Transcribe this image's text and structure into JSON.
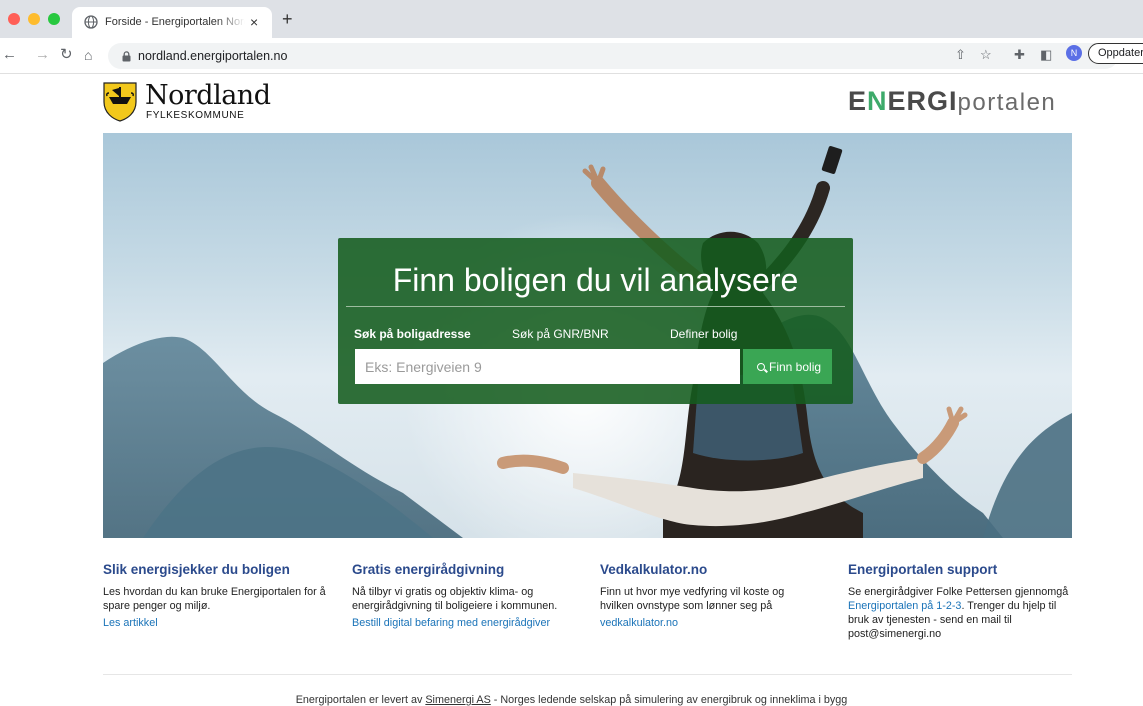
{
  "browser": {
    "tab_title": "Forside - Energiportalen Nordland",
    "tab_close": "×",
    "new_tab": "+",
    "url": "nordland.energiportalen.no",
    "profile_initial": "N",
    "update_label": "Oppdater"
  },
  "header": {
    "left_logo_name": "Nordland",
    "left_logo_sub": "FYLKESKOMMUNE",
    "right_logo": {
      "part1": "E",
      "part2": "N",
      "part3": "ERGI",
      "part4": "portalen"
    }
  },
  "search": {
    "title": "Finn boligen du vil analysere",
    "tabs": [
      {
        "label": "Søk på boligadresse",
        "active": true
      },
      {
        "label": "Søk på GNR/BNR",
        "active": false
      },
      {
        "label": "Definer bolig",
        "active": false
      }
    ],
    "placeholder": "Eks: Energiveien 9",
    "button_label": "Finn bolig"
  },
  "info": [
    {
      "title": "Slik energisjekker du boligen",
      "text": "Les hvordan du kan bruke Energiportalen for å spare penger og miljø.",
      "link": "Les artikkel"
    },
    {
      "title": "Gratis energirådgivning",
      "text": "Nå tilbyr vi gratis og objektiv klima- og energirådgivning til boligeiere i kommunen.",
      "link": "Bestill digital befaring med energirådgiver"
    },
    {
      "title": "Vedkalkulator.no",
      "text": "Finn ut hvor mye vedfyring vil koste og hvilken ovnstype som lønner seg på",
      "link": "vedkalkulator.no"
    },
    {
      "title": "Energiportalen support",
      "text_before": "Se energirådgiver Folke Pettersen gjennomgå",
      "link": "Energiportalen på 1-2-3",
      "text_after": ". Trenger du hjelp til bruk av tjenesten - send en mail til post@simenergi.no"
    }
  ],
  "footer": {
    "before": "Energiportalen er levert av",
    "link": "Simenergi AS",
    "after": "- Norges ledende selskap på simulering av energibruk og inneklima i bygg"
  }
}
